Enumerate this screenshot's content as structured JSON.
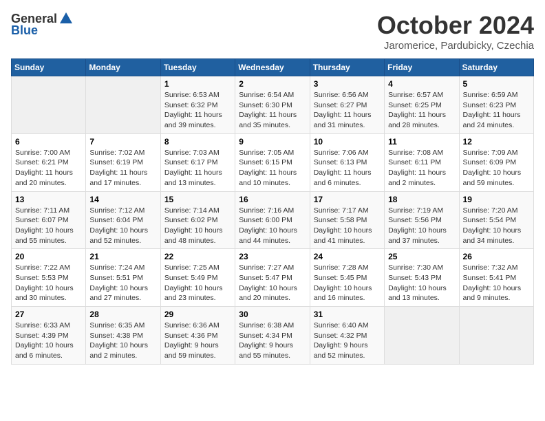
{
  "header": {
    "logo_general": "General",
    "logo_blue": "Blue",
    "month_title": "October 2024",
    "location": "Jaromerice, Pardubicky, Czechia"
  },
  "weekdays": [
    "Sunday",
    "Monday",
    "Tuesday",
    "Wednesday",
    "Thursday",
    "Friday",
    "Saturday"
  ],
  "weeks": [
    [
      {
        "day": "",
        "info": ""
      },
      {
        "day": "",
        "info": ""
      },
      {
        "day": "1",
        "info": "Sunrise: 6:53 AM\nSunset: 6:32 PM\nDaylight: 11 hours and 39 minutes."
      },
      {
        "day": "2",
        "info": "Sunrise: 6:54 AM\nSunset: 6:30 PM\nDaylight: 11 hours and 35 minutes."
      },
      {
        "day": "3",
        "info": "Sunrise: 6:56 AM\nSunset: 6:27 PM\nDaylight: 11 hours and 31 minutes."
      },
      {
        "day": "4",
        "info": "Sunrise: 6:57 AM\nSunset: 6:25 PM\nDaylight: 11 hours and 28 minutes."
      },
      {
        "day": "5",
        "info": "Sunrise: 6:59 AM\nSunset: 6:23 PM\nDaylight: 11 hours and 24 minutes."
      }
    ],
    [
      {
        "day": "6",
        "info": "Sunrise: 7:00 AM\nSunset: 6:21 PM\nDaylight: 11 hours and 20 minutes."
      },
      {
        "day": "7",
        "info": "Sunrise: 7:02 AM\nSunset: 6:19 PM\nDaylight: 11 hours and 17 minutes."
      },
      {
        "day": "8",
        "info": "Sunrise: 7:03 AM\nSunset: 6:17 PM\nDaylight: 11 hours and 13 minutes."
      },
      {
        "day": "9",
        "info": "Sunrise: 7:05 AM\nSunset: 6:15 PM\nDaylight: 11 hours and 10 minutes."
      },
      {
        "day": "10",
        "info": "Sunrise: 7:06 AM\nSunset: 6:13 PM\nDaylight: 11 hours and 6 minutes."
      },
      {
        "day": "11",
        "info": "Sunrise: 7:08 AM\nSunset: 6:11 PM\nDaylight: 11 hours and 2 minutes."
      },
      {
        "day": "12",
        "info": "Sunrise: 7:09 AM\nSunset: 6:09 PM\nDaylight: 10 hours and 59 minutes."
      }
    ],
    [
      {
        "day": "13",
        "info": "Sunrise: 7:11 AM\nSunset: 6:07 PM\nDaylight: 10 hours and 55 minutes."
      },
      {
        "day": "14",
        "info": "Sunrise: 7:12 AM\nSunset: 6:04 PM\nDaylight: 10 hours and 52 minutes."
      },
      {
        "day": "15",
        "info": "Sunrise: 7:14 AM\nSunset: 6:02 PM\nDaylight: 10 hours and 48 minutes."
      },
      {
        "day": "16",
        "info": "Sunrise: 7:16 AM\nSunset: 6:00 PM\nDaylight: 10 hours and 44 minutes."
      },
      {
        "day": "17",
        "info": "Sunrise: 7:17 AM\nSunset: 5:58 PM\nDaylight: 10 hours and 41 minutes."
      },
      {
        "day": "18",
        "info": "Sunrise: 7:19 AM\nSunset: 5:56 PM\nDaylight: 10 hours and 37 minutes."
      },
      {
        "day": "19",
        "info": "Sunrise: 7:20 AM\nSunset: 5:54 PM\nDaylight: 10 hours and 34 minutes."
      }
    ],
    [
      {
        "day": "20",
        "info": "Sunrise: 7:22 AM\nSunset: 5:53 PM\nDaylight: 10 hours and 30 minutes."
      },
      {
        "day": "21",
        "info": "Sunrise: 7:24 AM\nSunset: 5:51 PM\nDaylight: 10 hours and 27 minutes."
      },
      {
        "day": "22",
        "info": "Sunrise: 7:25 AM\nSunset: 5:49 PM\nDaylight: 10 hours and 23 minutes."
      },
      {
        "day": "23",
        "info": "Sunrise: 7:27 AM\nSunset: 5:47 PM\nDaylight: 10 hours and 20 minutes."
      },
      {
        "day": "24",
        "info": "Sunrise: 7:28 AM\nSunset: 5:45 PM\nDaylight: 10 hours and 16 minutes."
      },
      {
        "day": "25",
        "info": "Sunrise: 7:30 AM\nSunset: 5:43 PM\nDaylight: 10 hours and 13 minutes."
      },
      {
        "day": "26",
        "info": "Sunrise: 7:32 AM\nSunset: 5:41 PM\nDaylight: 10 hours and 9 minutes."
      }
    ],
    [
      {
        "day": "27",
        "info": "Sunrise: 6:33 AM\nSunset: 4:39 PM\nDaylight: 10 hours and 6 minutes."
      },
      {
        "day": "28",
        "info": "Sunrise: 6:35 AM\nSunset: 4:38 PM\nDaylight: 10 hours and 2 minutes."
      },
      {
        "day": "29",
        "info": "Sunrise: 6:36 AM\nSunset: 4:36 PM\nDaylight: 9 hours and 59 minutes."
      },
      {
        "day": "30",
        "info": "Sunrise: 6:38 AM\nSunset: 4:34 PM\nDaylight: 9 hours and 55 minutes."
      },
      {
        "day": "31",
        "info": "Sunrise: 6:40 AM\nSunset: 4:32 PM\nDaylight: 9 hours and 52 minutes."
      },
      {
        "day": "",
        "info": ""
      },
      {
        "day": "",
        "info": ""
      }
    ]
  ]
}
